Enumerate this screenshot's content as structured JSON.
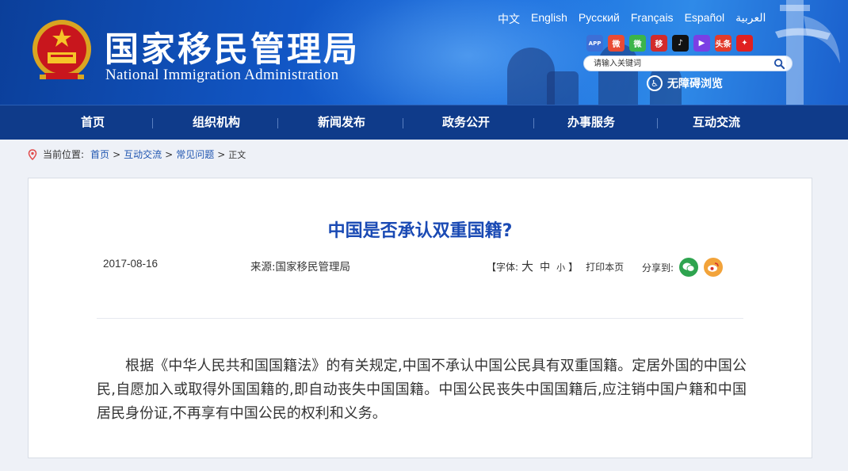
{
  "header": {
    "title": "国家移民管理局",
    "subtitle": "National Immigration Administration",
    "languages": [
      "中文",
      "English",
      "Русский",
      "Français",
      "Español",
      "العربية"
    ],
    "search_placeholder": "请输入关键词",
    "accessibility_label": "无障碍浏览",
    "social_icons": [
      {
        "name": "app-icon",
        "color": "#3d6fd6",
        "glyph": "APP"
      },
      {
        "name": "weibo-icon",
        "color": "#e94b35",
        "glyph": "微"
      },
      {
        "name": "wechat-icon",
        "color": "#3bb54a",
        "glyph": "微"
      },
      {
        "name": "toutiao-app-icon",
        "color": "#d22b2b",
        "glyph": "移"
      },
      {
        "name": "tiktok-icon",
        "color": "#111111",
        "glyph": "♪"
      },
      {
        "name": "kuaishou-icon",
        "color": "#7b3fe4",
        "glyph": "▶"
      },
      {
        "name": "headline-icon",
        "color": "#e23b2b",
        "glyph": "头条"
      },
      {
        "name": "news-icon",
        "color": "#e02020",
        "glyph": "✦"
      }
    ]
  },
  "nav": {
    "items": [
      "首页",
      "组织机构",
      "新闻发布",
      "政务公开",
      "办事服务",
      "互动交流"
    ]
  },
  "breadcrumb": {
    "label": "当前位置:",
    "links": [
      "首页",
      "互动交流",
      "常见问题"
    ],
    "current": "正文"
  },
  "article": {
    "title": "中国是否承认双重国籍?",
    "date": "2017-08-16",
    "source": "来源:国家移民管理局",
    "font_open": "【字体:",
    "font_large": "大",
    "font_medium": "中",
    "font_small": "小",
    "font_close": "】",
    "print": "打印本页",
    "share_label": "分享到:",
    "body": "根据《中华人民共和国国籍法》的有关规定,中国不承认中国公民具有双重国籍。定居外国的中国公民,自愿加入或取得外国国籍的,即自动丧失中国国籍。中国公民丧失中国国籍后,应注销中国户籍和中国居民身份证,不再享有中国公民的权利和义务。"
  },
  "colors": {
    "nav_bg": "#0f3b8a",
    "title_blue": "#1a4ab4",
    "link_blue": "#1f55b0"
  }
}
